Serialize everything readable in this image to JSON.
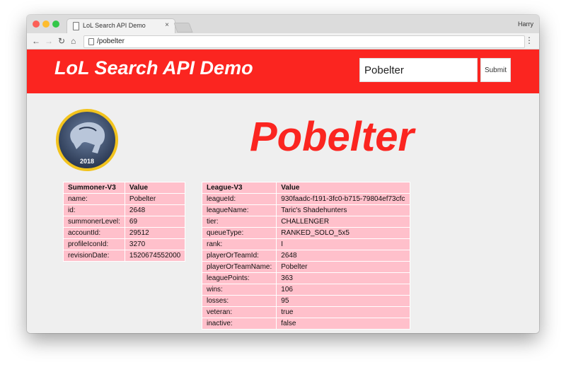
{
  "browser": {
    "tab_title": "LoL Search API Demo",
    "tab_close": "×",
    "profile_name": "Harry",
    "url": "/pobelter",
    "traffic_lights": {
      "close": "#fc5f57",
      "minimize": "#fdbc2e",
      "zoom": "#33c748"
    },
    "nav": {
      "back": "←",
      "forward": "→",
      "reload": "↻",
      "home": "⌂",
      "menu": "⋮"
    }
  },
  "header": {
    "title": "LoL Search API Demo",
    "search_value": "Pobelter",
    "submit_label": "Submit",
    "color": "#fb2520"
  },
  "profile_icon": {
    "year": "2018",
    "ring_color": "#f2c31d"
  },
  "summoner_name": "Pobelter",
  "summoner_table": {
    "headers": [
      "Summoner-V3",
      "Value"
    ],
    "rows": [
      [
        "name:",
        "Pobelter"
      ],
      [
        "id:",
        "2648"
      ],
      [
        "summonerLevel:",
        "69"
      ],
      [
        "accountId:",
        "29512"
      ],
      [
        "profileIconId:",
        "3270"
      ],
      [
        "revisionDate:",
        "1520674552000"
      ]
    ]
  },
  "league_table": {
    "headers": [
      "League-V3",
      "Value"
    ],
    "rows": [
      [
        "leagueId:",
        "930faadc-f191-3fc0-b715-79804ef73cfc"
      ],
      [
        "leagueName:",
        "Taric's Shadehunters"
      ],
      [
        "tier:",
        "CHALLENGER"
      ],
      [
        "queueType:",
        "RANKED_SOLO_5x5"
      ],
      [
        "rank:",
        "I"
      ],
      [
        "playerOrTeamId:",
        "2648"
      ],
      [
        "playerOrTeamName:",
        "Pobelter"
      ],
      [
        "leaguePoints:",
        "363"
      ],
      [
        "wins:",
        "106"
      ],
      [
        "losses:",
        "95"
      ],
      [
        "veteran:",
        "true"
      ],
      [
        "inactive:",
        "false"
      ]
    ]
  }
}
